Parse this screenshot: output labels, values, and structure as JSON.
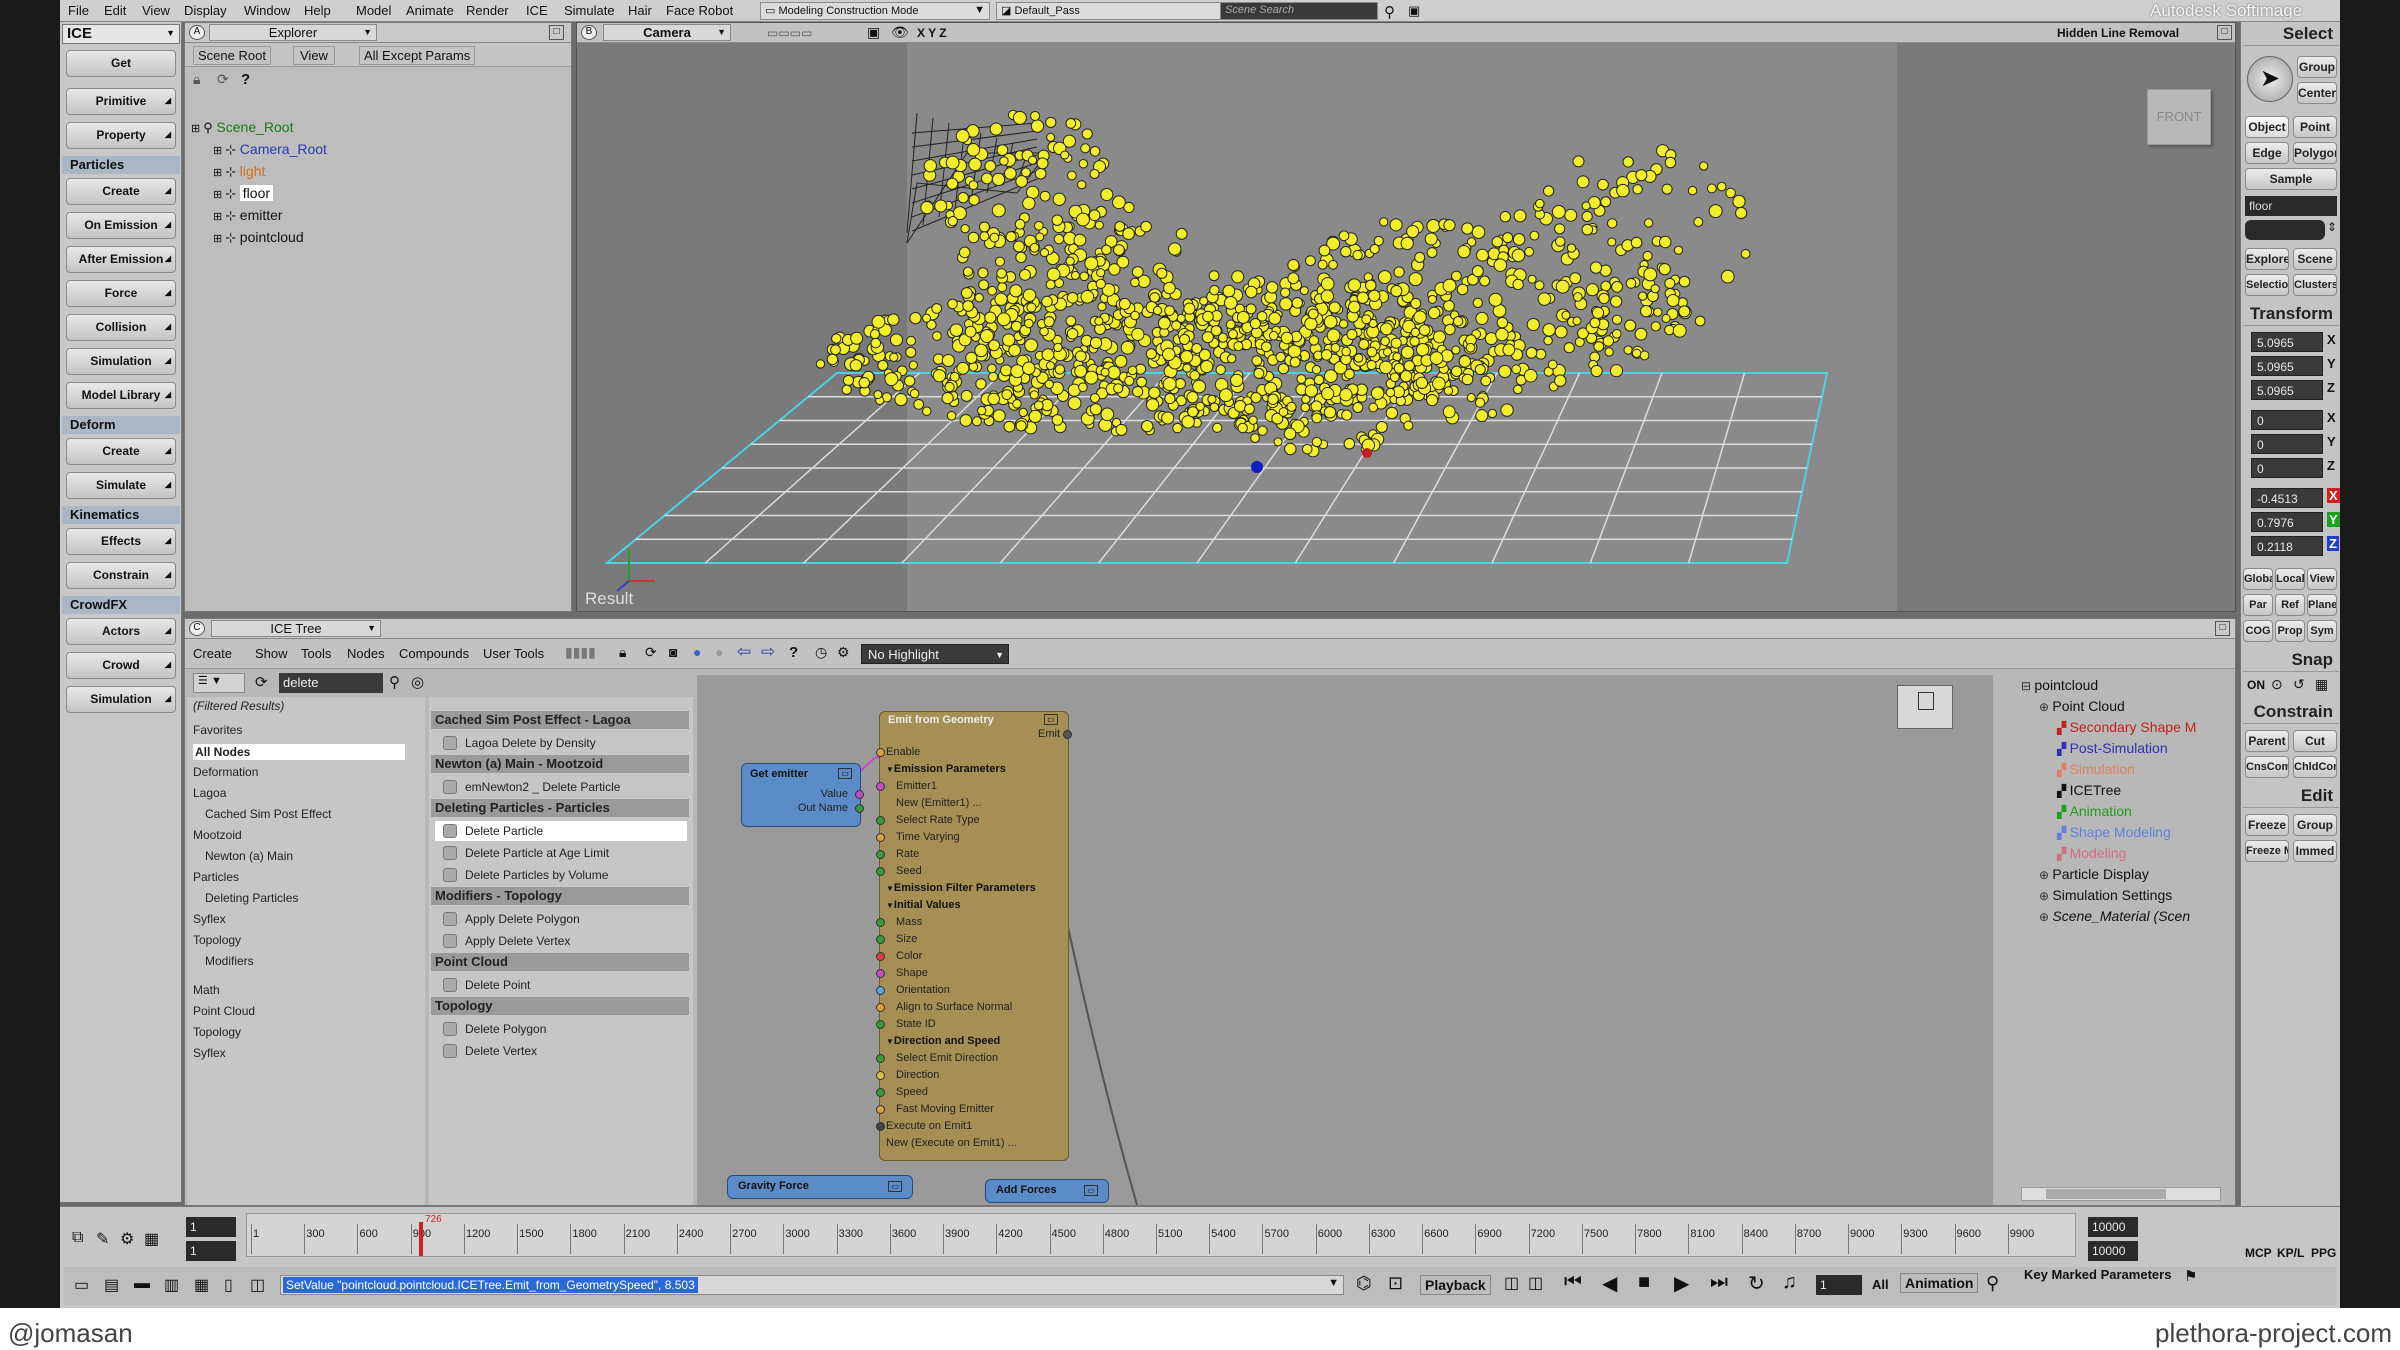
{
  "menubar": {
    "items": [
      "File",
      "Edit",
      "View",
      "Display",
      "Window",
      "Help",
      "Model",
      "Animate",
      "Render",
      "ICE",
      "Simulate",
      "Hair",
      "Face Robot"
    ],
    "mode": "Modeling Construction Mode",
    "pass": "Default_Pass",
    "search_placeholder": "Scene Search",
    "brand": "Autodesk Softimage"
  },
  "left_panel": {
    "module": "ICE",
    "items": [
      {
        "type": "btn",
        "label": "Get"
      },
      {
        "type": "btn",
        "label": "Primitive"
      },
      {
        "type": "btn",
        "label": "Property"
      },
      {
        "type": "head",
        "label": "Particles"
      },
      {
        "type": "btn",
        "label": "Create"
      },
      {
        "type": "btn",
        "label": "On Emission"
      },
      {
        "type": "btn",
        "label": "After Emission"
      },
      {
        "type": "btn",
        "label": "Force"
      },
      {
        "type": "btn",
        "label": "Collision"
      },
      {
        "type": "btn",
        "label": "Simulation"
      },
      {
        "type": "btn",
        "label": "Model Library"
      },
      {
        "type": "head",
        "label": "Deform"
      },
      {
        "type": "btn",
        "label": "Create"
      },
      {
        "type": "btn",
        "label": "Simulate"
      },
      {
        "type": "head",
        "label": "Kinematics"
      },
      {
        "type": "btn",
        "label": "Effects"
      },
      {
        "type": "btn",
        "label": "Constrain"
      },
      {
        "type": "head",
        "label": "CrowdFX"
      },
      {
        "type": "btn",
        "label": "Actors"
      },
      {
        "type": "btn",
        "label": "Crowd"
      },
      {
        "type": "btn",
        "label": "Simulation"
      }
    ]
  },
  "explorer": {
    "title": "Explorer",
    "toolbar": [
      "Scene Root",
      "View",
      "All Except Params"
    ],
    "tree": [
      {
        "label": "Scene_Root",
        "color": "#1a7a1a"
      },
      {
        "label": "Camera_Root",
        "color": "#2a3aa8"
      },
      {
        "label": "light",
        "color": "#d07020"
      },
      {
        "label": "floor",
        "color": "#111111"
      },
      {
        "label": "emitter",
        "color": "#111111"
      },
      {
        "label": "pointcloud",
        "color": "#111111"
      }
    ]
  },
  "viewport": {
    "camera": "Camera",
    "axes": "X Y Z",
    "mode": "Hidden Line Removal",
    "view_cube": "FRONT",
    "result": "Result"
  },
  "icetree": {
    "title": "ICE Tree",
    "menu": [
      "Create",
      "Show",
      "Tools",
      "Nodes",
      "Compounds",
      "User Tools"
    ],
    "highlight": "No Highlight",
    "search_value": "delete",
    "filtered": "(Filtered Results)",
    "nodelist": [
      "Favorites",
      "All Nodes",
      "Deformation",
      "Lagoa",
      "Cached Sim Post Effect",
      "Mootzoid",
      "Newton (a) Main",
      "Particles",
      "Deleting Particles",
      "Syflex",
      "Topology",
      "Modifiers",
      "Math",
      "Point Cloud",
      "Topology",
      "Syflex"
    ],
    "presets": [
      {
        "type": "h",
        "label": "Cached Sim Post Effect - Lagoa"
      },
      {
        "type": "i",
        "label": "Lagoa Delete by Density"
      },
      {
        "type": "h",
        "label": "Newton (a) Main - Mootzoid"
      },
      {
        "type": "i",
        "label": "emNewton2 _ Delete Particle"
      },
      {
        "type": "h",
        "label": "Deleting Particles - Particles"
      },
      {
        "type": "i",
        "label": "Delete Particle"
      },
      {
        "type": "i",
        "label": "Delete Particle at Age Limit"
      },
      {
        "type": "i",
        "label": "Delete Particles by Volume"
      },
      {
        "type": "h",
        "label": "Modifiers - Topology"
      },
      {
        "type": "i",
        "label": "Apply Delete Polygon"
      },
      {
        "type": "i",
        "label": "Apply Delete Vertex"
      },
      {
        "type": "h",
        "label": "Point Cloud"
      },
      {
        "type": "i",
        "label": "Delete Point"
      },
      {
        "type": "h",
        "label": "Topology"
      },
      {
        "type": "i",
        "label": "Delete Polygon"
      },
      {
        "type": "i",
        "label": "Delete Vertex"
      }
    ],
    "get_node": {
      "title": "Get emitter",
      "ports": [
        "Value",
        "Out Name"
      ]
    },
    "emit_node": {
      "title": "Emit from Geometry",
      "out": "Emit",
      "rows": [
        {
          "t": "p",
          "label": "Enable",
          "c": "#d8a040"
        },
        {
          "t": "s",
          "label": "Emission Parameters"
        },
        {
          "t": "p",
          "label": "Emitter1",
          "c": "#c050c0"
        },
        {
          "t": "p",
          "label": "New (Emitter1) ...",
          "c": ""
        },
        {
          "t": "p",
          "label": "Select Rate Type",
          "c": "#3a9a3a"
        },
        {
          "t": "p",
          "label": "Time Varying",
          "c": "#d8a040"
        },
        {
          "t": "p",
          "label": "Rate",
          "c": "#3a9a3a"
        },
        {
          "t": "p",
          "label": "Seed",
          "c": "#3a9a3a"
        },
        {
          "t": "s",
          "label": "Emission Filter Parameters"
        },
        {
          "t": "s",
          "label": "Initial Values"
        },
        {
          "t": "p",
          "label": "Mass",
          "c": "#3a9a3a"
        },
        {
          "t": "p",
          "label": "Size",
          "c": "#3a9a3a"
        },
        {
          "t": "p",
          "label": "Color",
          "c": "#d84040"
        },
        {
          "t": "p",
          "label": "Shape",
          "c": "#c050c0"
        },
        {
          "t": "p",
          "label": "Orientation",
          "c": "#5aa8d8"
        },
        {
          "t": "p",
          "label": "Align to Surface Normal",
          "c": "#d8a040"
        },
        {
          "t": "p",
          "label": "State ID",
          "c": "#3a9a3a"
        },
        {
          "t": "s",
          "label": "Direction and Speed"
        },
        {
          "t": "p",
          "label": "Select Emit Direction",
          "c": "#3a9a3a"
        },
        {
          "t": "p",
          "label": "Direction",
          "c": "#d8c040"
        },
        {
          "t": "p",
          "label": "Speed",
          "c": "#3a9a3a"
        },
        {
          "t": "p",
          "label": "Fast Moving Emitter",
          "c": "#d8a040"
        },
        {
          "t": "p",
          "label": "Execute on Emit1",
          "c": "#444444"
        },
        {
          "t": "p",
          "label": "New (Execute on Emit1) ...",
          "c": ""
        }
      ]
    },
    "gravity_node": "Gravity Force",
    "addforces_node": "Add Forces",
    "outliner": [
      {
        "label": "pointcloud",
        "color": "#111111",
        "ind": 0
      },
      {
        "label": "Point Cloud",
        "color": "#111111",
        "ind": 1
      },
      {
        "label": "Secondary Shape M",
        "color": "#c02020",
        "ind": 2
      },
      {
        "label": "Post-Simulation",
        "color": "#3030b0",
        "ind": 2
      },
      {
        "label": "Simulation",
        "color": "#e08060",
        "ind": 2
      },
      {
        "label": "ICETree",
        "color": "#111111",
        "ind": 2
      },
      {
        "label": "Animation",
        "color": "#20a020",
        "ind": 2
      },
      {
        "label": "Shape Modeling",
        "color": "#6080e0",
        "ind": 2
      },
      {
        "label": "Modeling",
        "color": "#d07080",
        "ind": 2
      },
      {
        "label": "Particle Display",
        "color": "#111111",
        "ind": 1
      },
      {
        "label": "Simulation Settings",
        "color": "#111111",
        "ind": 1
      },
      {
        "label": "Scene_Material (Scen",
        "color": "#111111",
        "ind": 1
      }
    ]
  },
  "timeline": {
    "start": "1",
    "current": "1",
    "end": "10000",
    "end2": "10000",
    "playhead_label": "726",
    "ticks": [
      "1",
      "300",
      "600",
      "900",
      "1200",
      "1500",
      "1800",
      "2100",
      "2400",
      "2700",
      "3000",
      "3300",
      "3600",
      "3900",
      "4200",
      "4500",
      "4800",
      "5100",
      "5400",
      "5700",
      "6000",
      "6300",
      "6600",
      "6900",
      "7200",
      "7500",
      "7800",
      "8100",
      "8400",
      "8700",
      "9000",
      "9300",
      "9600",
      "9900"
    ],
    "command": "SetValue \"pointcloud.pointcloud.ICETree.Emit_from_GeometrySpeed\", 8.503",
    "playback": "Playback",
    "frame": "1",
    "all": "All",
    "animation": "Animation",
    "key_marked": "Key Marked Parameters"
  },
  "right_panel": {
    "select": "Select",
    "group": "Group",
    "center": "Center",
    "object": "Object",
    "point": "Point",
    "edge": "Edge",
    "polygon": "Polygon",
    "sample": "Sample",
    "selected_name": "floor",
    "explore": "Explore",
    "scene": "Scene",
    "selection": "Selection",
    "clusters": "Clusters",
    "transform": "Transform",
    "scale": [
      "5.0965",
      "5.0965",
      "5.0965"
    ],
    "rotate": [
      "0",
      "0",
      "0"
    ],
    "translate": [
      "-0.4513",
      "0.7976",
      "0.2118"
    ],
    "axes": [
      "X",
      "Y",
      "Z"
    ],
    "global": "Global",
    "local": "Local",
    "view": "View",
    "par": "Par",
    "ref": "Ref",
    "plane": "Plane",
    "cog": "COG",
    "prop": "Prop",
    "sym": "Sym",
    "snap": "Snap",
    "on": "ON",
    "constrain": "Constrain",
    "parent": "Parent",
    "cut": "Cut",
    "cnscomp": "CnsComp",
    "chldcomp": "ChldComp",
    "edit": "Edit",
    "freeze": "Freeze",
    "group2": "Group",
    "freezem": "Freeze M",
    "immed": "Immed",
    "mcp": "MCP",
    "kpl": "KP/L",
    "ppg": "PPG"
  },
  "credits": {
    "left": "@jomasan",
    "right": "plethora-project.com"
  }
}
